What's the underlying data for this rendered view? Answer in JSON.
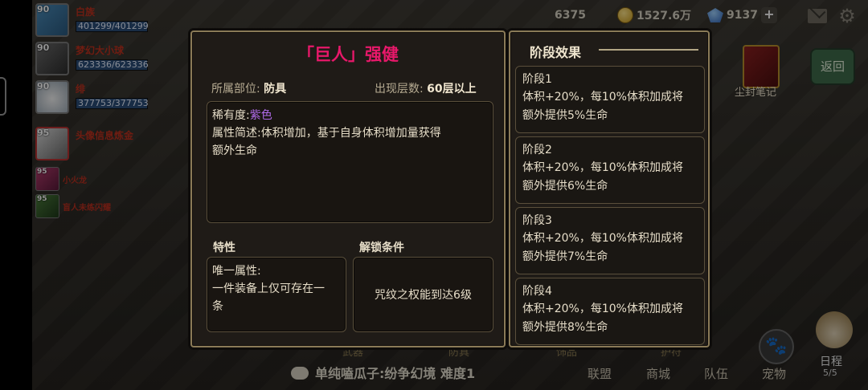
{
  "topbar": {
    "gold_count": "6375",
    "coins": "1527.6万",
    "gems": "9137",
    "plus": "+"
  },
  "party": [
    {
      "level": "90",
      "name": "白族",
      "hp": "401299/401299"
    },
    {
      "level": "90",
      "name": "梦幻大小球",
      "hp": "623336/623336"
    },
    {
      "level": "90",
      "name": "绯",
      "hp": "377753/377753"
    },
    {
      "level": "95",
      "name": "头像信息炼金",
      "hp": ""
    }
  ],
  "party_small": [
    {
      "level": "95",
      "name": "小火龙"
    },
    {
      "level": "95",
      "name": "盲人未练闪耀"
    }
  ],
  "right_buttons": {
    "back_label": "返回",
    "book_label": "尘封笔记",
    "pet_label": "宠物",
    "schedule_label": "日程",
    "schedule_count": "5/5"
  },
  "bottom_nav": [
    "联盟",
    "商城",
    "队伍"
  ],
  "chat": {
    "text": "单纯嗑瓜子:纷争幻境 难度1"
  },
  "under_tabs": [
    "武器",
    "防具",
    "饰品",
    "护符"
  ],
  "item": {
    "title": "「巨人」强健",
    "slot_label": "所属部位:",
    "slot_value": "防具",
    "floor_label": "出现层数:",
    "floor_value": "60层以上",
    "rarity_label": "稀有度:",
    "rarity_value": "紫色",
    "desc_line1": "属性简述:体积增加，基于自身体积增加量获得",
    "desc_line2": "额外生命",
    "feature_label": "特性",
    "unlock_label": "解锁条件",
    "feature_line1": "唯一属性:",
    "feature_line2": "一件装备上仅可存在一",
    "feature_line3": "条",
    "unlock_text": "咒纹之权能到达6级"
  },
  "stages": {
    "title": "阶段效果",
    "items": [
      {
        "name": "阶段1",
        "line1": "体积+20%，每10%体积加成将",
        "line2": "额外提供5%生命"
      },
      {
        "name": "阶段2",
        "line1": "体积+20%，每10%体积加成将",
        "line2": "额外提供6%生命"
      },
      {
        "name": "阶段3",
        "line1": "体积+20%，每10%体积加成将",
        "line2": "额外提供7%生命"
      },
      {
        "name": "阶段4",
        "line1": "体积+20%，每10%体积加成将",
        "line2": "额外提供8%生命"
      }
    ]
  },
  "colors": {
    "title_pink": "#e8186a",
    "rarity_purple": "#b06ae8",
    "panel_border": "#8a7a57"
  }
}
